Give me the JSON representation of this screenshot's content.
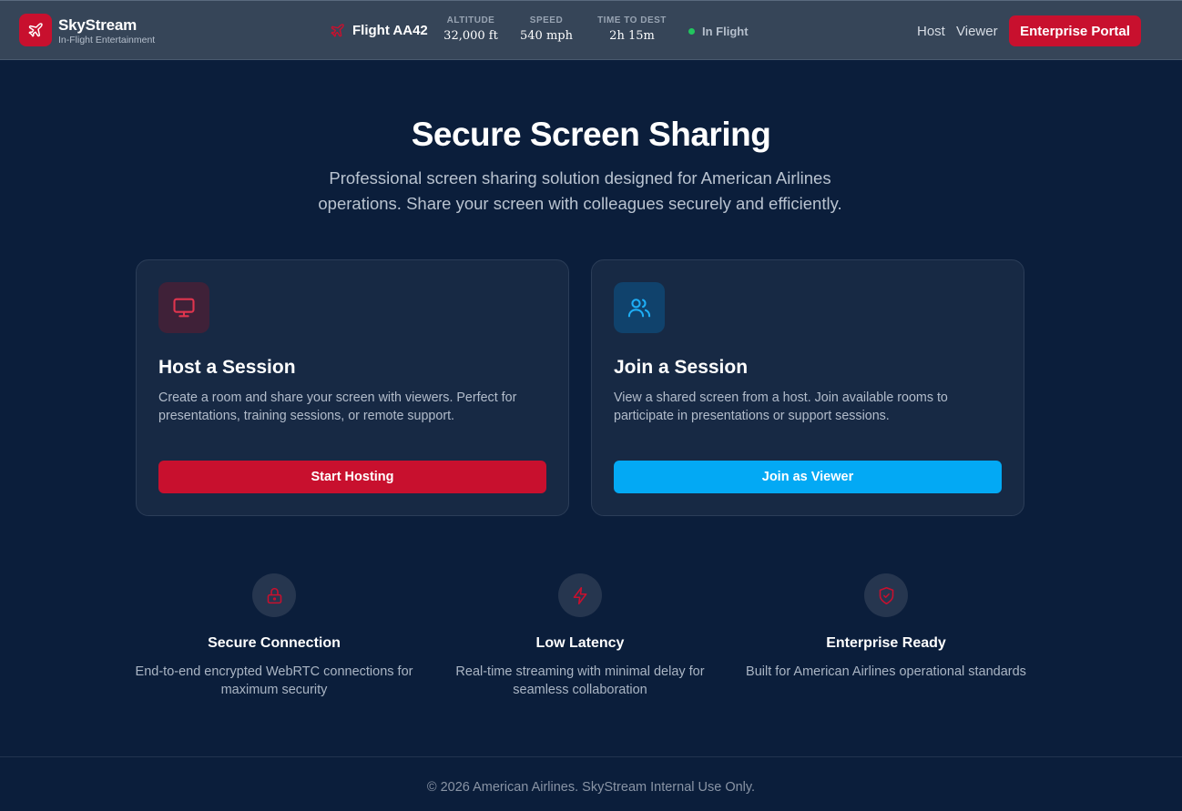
{
  "colors": {
    "accent_red": "#c8102e",
    "accent_blue": "#03a9f4",
    "background": "#0b1e3b",
    "status_green": "#22c55e"
  },
  "header": {
    "brand_name": "SkyStream",
    "brand_sub": "In-Flight Entertainment",
    "logo_icon": "plane-icon",
    "flight_icon": "plane-icon",
    "flight_name": "Flight AA42",
    "stats": [
      {
        "label": "ALTITUDE",
        "value": "32,000 ft"
      },
      {
        "label": "SPEED",
        "value": "540 mph"
      },
      {
        "label": "TIME TO DEST",
        "value": "2h 15m"
      }
    ],
    "status": "In Flight",
    "nav": {
      "host": "Host",
      "viewer": "Viewer"
    },
    "portal_button": "Enterprise Portal"
  },
  "hero": {
    "title": "Secure Screen Sharing",
    "subtitle": "Professional screen sharing solution designed for American Airlines operations. Share your screen with colleagues securely and efficiently."
  },
  "cards": [
    {
      "icon": "monitor-icon",
      "title": "Host a Session",
      "description": "Create a room and share your screen with viewers. Perfect for presentations, training sessions, or remote support.",
      "button": "Start Hosting"
    },
    {
      "icon": "users-icon",
      "title": "Join a Session",
      "description": "View a shared screen from a host. Join available rooms to participate in presentations or support sessions.",
      "button": "Join as Viewer"
    }
  ],
  "features": [
    {
      "icon": "lock-icon",
      "title": "Secure Connection",
      "description": "End-to-end encrypted WebRTC connections for maximum security"
    },
    {
      "icon": "lightning-icon",
      "title": "Low Latency",
      "description": "Real-time streaming with minimal delay for seamless collaboration"
    },
    {
      "icon": "shield-check-icon",
      "title": "Enterprise Ready",
      "description": "Built for American Airlines operational standards"
    }
  ],
  "footer": "© 2026 American Airlines. SkyStream Internal Use Only."
}
